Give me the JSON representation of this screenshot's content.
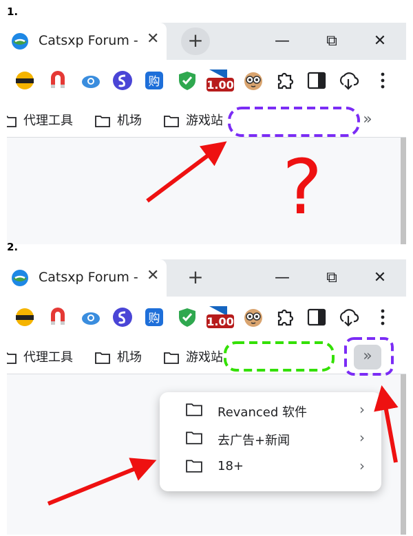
{
  "steps": [
    {
      "label": "1.",
      "tab_title": "Catsxp Forum -",
      "tab_close": "✕",
      "new_tab": "+",
      "window_controls": {
        "minimize": "—",
        "restore": "⧉",
        "close": "✕"
      },
      "extension_badge": "1.00",
      "bookmarks": [
        "代理工具",
        "机场",
        "游戏站"
      ],
      "overflow_chevron": "»"
    },
    {
      "label": "2.",
      "tab_title": "Catsxp Forum -",
      "tab_close": "✕",
      "new_tab": "+",
      "window_controls": {
        "minimize": "—",
        "restore": "⧉",
        "close": "✕"
      },
      "extension_badge": "1.00",
      "bookmarks": [
        "代理工具",
        "机场",
        "游戏站"
      ],
      "overflow_chevron": "»",
      "overflow_menu": [
        {
          "label": "Revanced 软件",
          "arrow": "›"
        },
        {
          "label": "去广告+新闻",
          "arrow": "›"
        },
        {
          "label": "18+",
          "arrow": "›"
        }
      ]
    }
  ],
  "annotations": {
    "highlight_missing_color": "#7b2cf5",
    "highlight_found_color": "#33e000",
    "arrow_color": "#ee1111",
    "question_mark": "?"
  }
}
